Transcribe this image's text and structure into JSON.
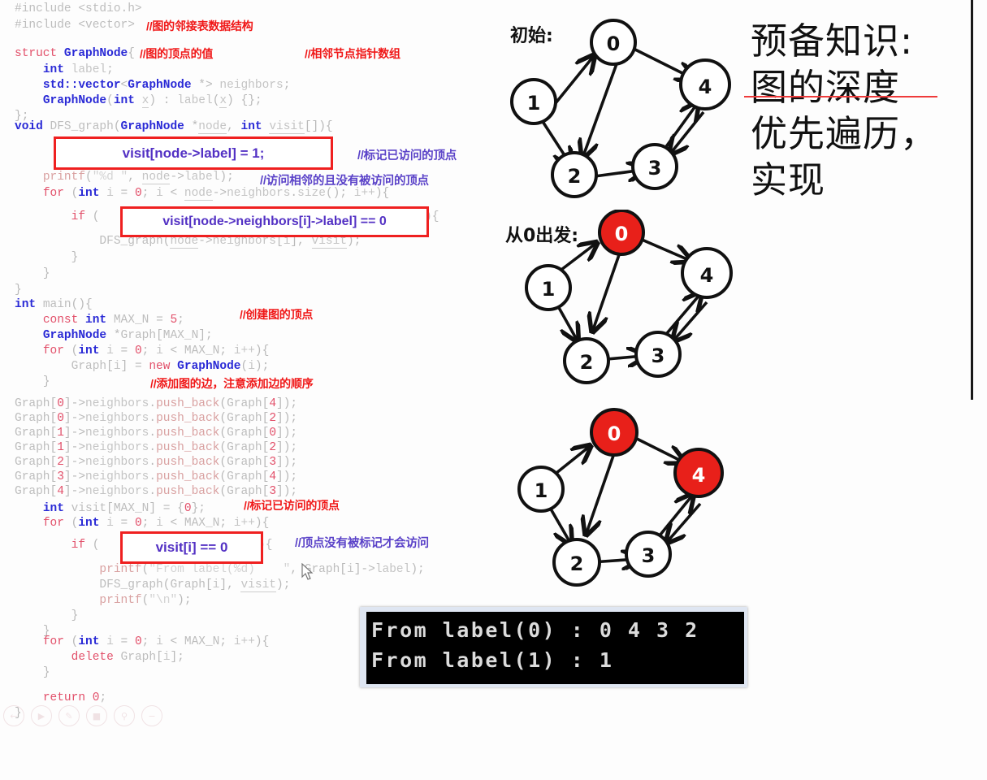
{
  "title": {
    "lines": [
      "预备知识:",
      "图的深度",
      "优先遍历，",
      "实现"
    ],
    "strike_color": "#ef3b3b"
  },
  "code": {
    "language": "C++",
    "lines": [
      "#include <stdio.h>",
      "#include <vector>",
      "struct GraphNode{",
      "    int label;",
      "    std::vector<GraphNode *> neighbors;",
      "    GraphNode(int x) : label(x) {};",
      "};",
      "void DFS_graph(GraphNode *node, int visit[]){",
      "    printf(\"%d \", node->label);",
      "    for (int i = 0; i < node->neighbors.size(); i++){",
      "        if (                                        ){",
      "            DFS_graph(node->neighbors[i], visit);",
      "        }",
      "    }",
      "}",
      "int main(){",
      "    const int MAX_N = 5;",
      "    GraphNode *Graph[MAX_N];",
      "    for (int i = 0; i < MAX_N; i++){",
      "        Graph[i] = new GraphNode(i);",
      "    }",
      "    Graph[0]->neighbors.push_back(Graph[4]);",
      "    Graph[0]->neighbors.push_back(Graph[2]);",
      "    Graph[1]->neighbors.push_back(Graph[0]);",
      "    Graph[1]->neighbors.push_back(Graph[2]);",
      "    Graph[2]->neighbors.push_back(Graph[3]);",
      "    Graph[3]->neighbors.push_back(Graph[4]);",
      "    Graph[4]->neighbors.push_back(Graph[3]);",
      "    int visit[MAX_N] = {0};",
      "    for (int i = 0; i < MAX_N; i++){",
      "        if (              ){",
      "            printf(\"From label(%d) : \", Graph[i]->label);",
      "            DFS_graph(Graph[i], visit);",
      "            printf(\"\\n\");",
      "        }",
      "    }",
      "    for (int i = 0; i < MAX_N; i++){",
      "        delete Graph[i];",
      "    }",
      "    return 0;",
      "}"
    ]
  },
  "highlight_boxes": [
    {
      "name": "visit-assign",
      "text": "visit[node->label] = 1;"
    },
    {
      "name": "visit-neighbor-check",
      "text": "visit[node->neighbors[i]->label] == 0"
    },
    {
      "name": "visit-i-check",
      "text": "visit[i] == 0"
    }
  ],
  "annotations": [
    {
      "text": "//图的邻接表数据结构",
      "color": "red"
    },
    {
      "text": "//图的顶点的值",
      "color": "red"
    },
    {
      "text": "//相邻节点指针数组",
      "color": "red"
    },
    {
      "text": "//标记已访问的顶点",
      "color": "blue"
    },
    {
      "text": "//访问相邻的且没有被访问的顶点",
      "color": "blue"
    },
    {
      "text": "//创建图的顶点",
      "color": "red"
    },
    {
      "text": "//添加图的边，注意添加边的顺序",
      "color": "red"
    },
    {
      "text": "//标记已访问的顶点",
      "color": "red"
    },
    {
      "text": "//顶点没有被标记才会访问",
      "color": "blue"
    }
  ],
  "graphs": [
    {
      "caption": "初始:",
      "nodes": [
        {
          "label": "0",
          "highlighted": false
        },
        {
          "label": "1",
          "highlighted": false
        },
        {
          "label": "2",
          "highlighted": false
        },
        {
          "label": "3",
          "highlighted": false
        },
        {
          "label": "4",
          "highlighted": false
        }
      ],
      "edges": [
        "1->0",
        "0->4",
        "0->2",
        "1->2",
        "2->3",
        "3->4",
        "4->3"
      ]
    },
    {
      "caption": "从0出发:",
      "nodes": [
        {
          "label": "0",
          "highlighted": true
        },
        {
          "label": "1",
          "highlighted": false
        },
        {
          "label": "2",
          "highlighted": false
        },
        {
          "label": "3",
          "highlighted": false
        },
        {
          "label": "4",
          "highlighted": false
        }
      ],
      "edges": [
        "1->0",
        "0->4",
        "0->2",
        "1->2",
        "2->3",
        "3->4",
        "4->3"
      ]
    },
    {
      "caption": "",
      "nodes": [
        {
          "label": "0",
          "highlighted": true
        },
        {
          "label": "1",
          "highlighted": false
        },
        {
          "label": "2",
          "highlighted": false
        },
        {
          "label": "3",
          "highlighted": false
        },
        {
          "label": "4",
          "highlighted": true
        }
      ],
      "edges": [
        "1->0",
        "0->4",
        "0->2",
        "1->2",
        "2->3",
        "3->4",
        "4->3"
      ]
    }
  ],
  "console": {
    "lines": [
      "From label(0) : 0 4 3 2",
      "From label(1) : 1"
    ]
  },
  "toolbar": {
    "buttons": [
      "back-icon",
      "play-icon",
      "edit-icon",
      "image-icon",
      "search-icon",
      "minus-icon"
    ]
  },
  "node_colors": {
    "highlight_fill": "#e8201a",
    "normal_fill": "#ffffff",
    "stroke": "#111111"
  }
}
